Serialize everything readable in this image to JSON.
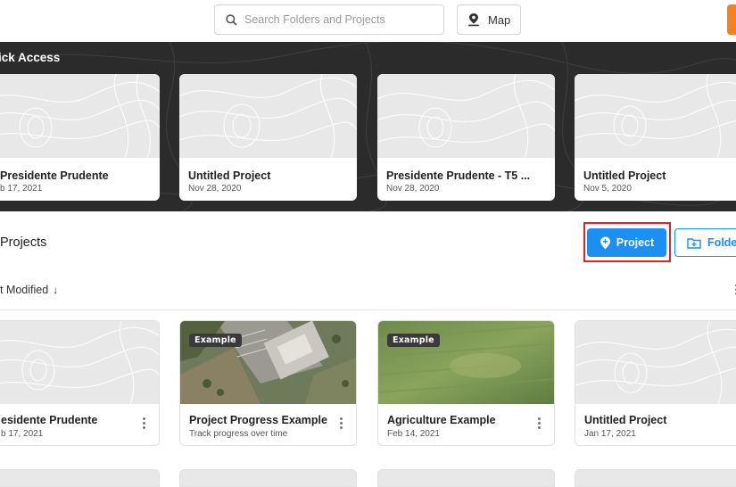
{
  "topbar": {
    "search_placeholder": "Search Folders and Projects",
    "map_label": "Map",
    "accent_color": "#f5821f"
  },
  "quick_access": {
    "title": "ick Access",
    "cards": [
      {
        "title": "Presidente Prudente",
        "date": "b 17, 2021"
      },
      {
        "title": "Untitled Project",
        "date": "Nov 28, 2020"
      },
      {
        "title": "Presidente Prudente - T5 ...",
        "date": "Nov 28, 2020"
      },
      {
        "title": "Untitled Project",
        "date": "Nov 5, 2020"
      }
    ]
  },
  "projects": {
    "title": "Projects",
    "new_project_label": "Project",
    "new_folder_label": "Folde",
    "sort_label": "t Modified",
    "sort_icon": "arrow-down-icon",
    "primary_color": "#1b90f2",
    "highlight_color": "#e32222",
    "cards": [
      {
        "title": "esidente Prudente",
        "subtitle": "b 17, 2021",
        "badge": "",
        "thumb": "topo"
      },
      {
        "title": "Project Progress Example",
        "subtitle": "Track progress over time",
        "badge": "Example",
        "thumb": "aerial-building"
      },
      {
        "title": "Agriculture Example",
        "subtitle": "Feb 14, 2021",
        "badge": "Example",
        "thumb": "aerial-field"
      },
      {
        "title": "Untitled Project",
        "subtitle": "Jan 17, 2021",
        "badge": "",
        "thumb": "topo"
      }
    ]
  }
}
